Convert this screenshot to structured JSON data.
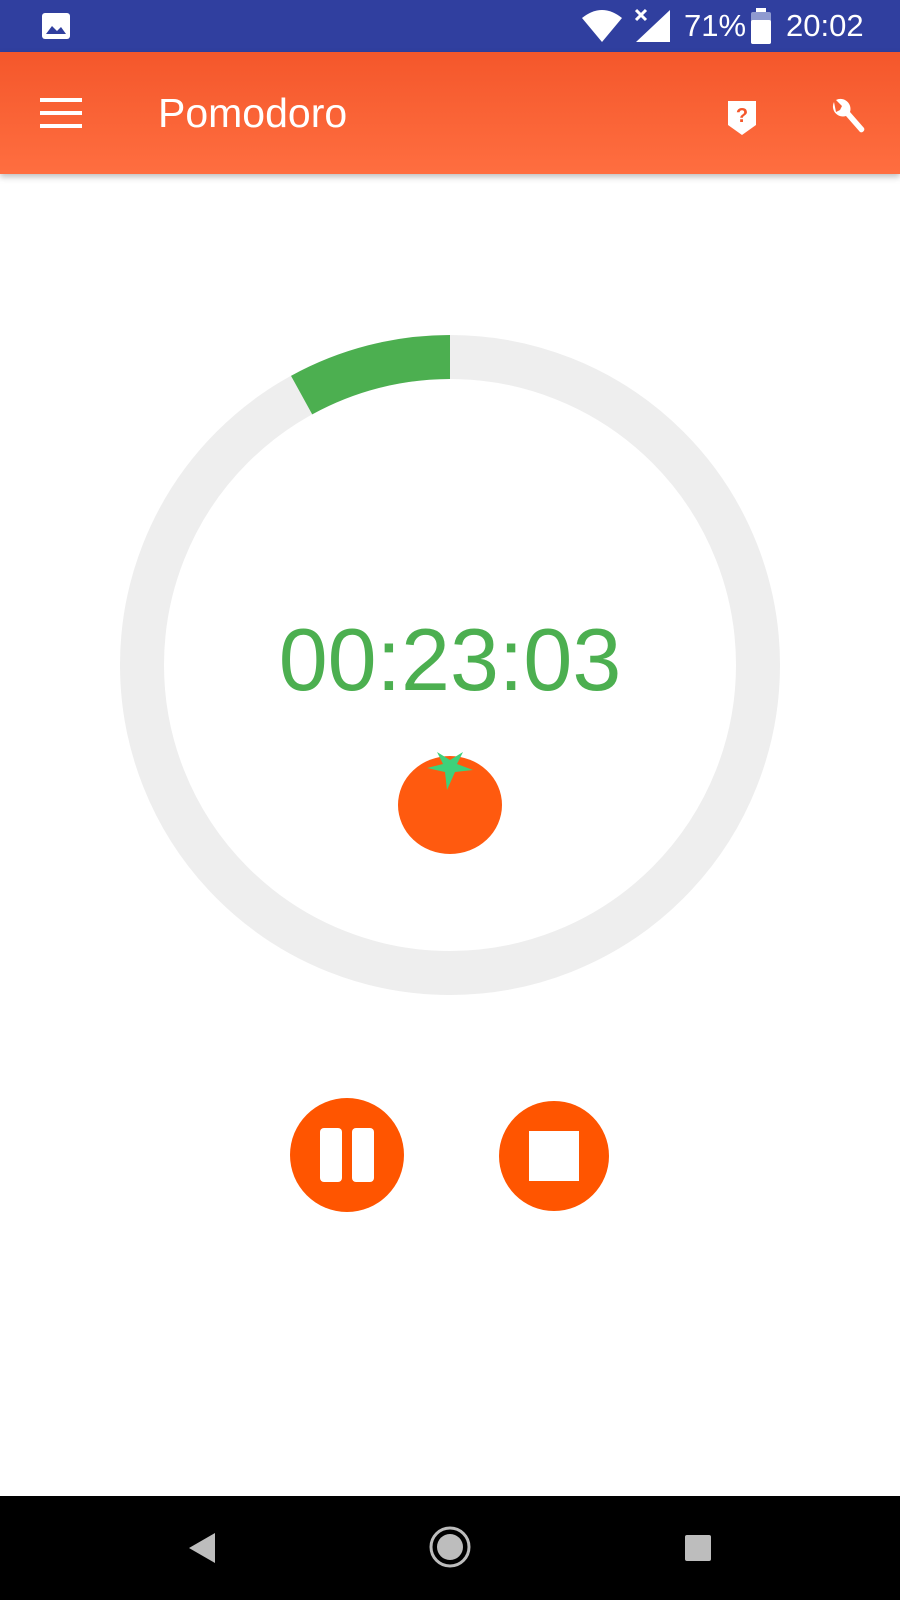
{
  "status_bar": {
    "battery_percent": "71%",
    "time": "20:02",
    "icons": [
      "gallery-icon",
      "wifi-icon",
      "signal-icon",
      "battery-icon"
    ]
  },
  "app_bar": {
    "title": "Pomodoro",
    "icons": [
      "menu-icon",
      "help-icon",
      "wrench-icon"
    ]
  },
  "timer": {
    "time_remaining": "00:23:03",
    "progress_fraction": 0.08,
    "icon": "tomato-icon"
  },
  "controls": {
    "icons": [
      "pause-icon",
      "stop-icon"
    ]
  },
  "nav_bar": {
    "icons": [
      "back-icon",
      "home-icon",
      "recents-icon"
    ]
  },
  "colors": {
    "status_bar": "#303f9f",
    "app_bar": "#ff6a3d",
    "accent": "#ff5500",
    "progress": "#4caf50",
    "track": "#eeeeee",
    "timer_text": "#4caf50",
    "tomato": "#ff5a0f",
    "tomato_leaves": "#3ed17a"
  }
}
